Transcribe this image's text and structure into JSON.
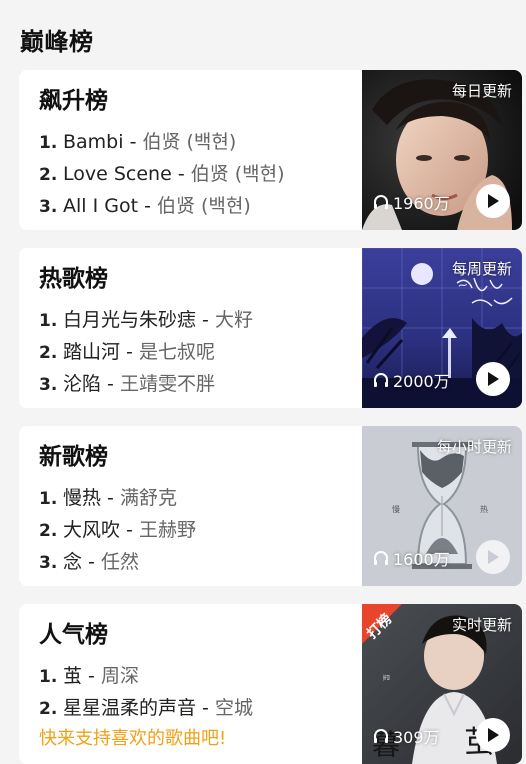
{
  "page": {
    "section_title": "巅峰榜"
  },
  "charts": [
    {
      "title": "飙升榜",
      "update": "每日更新",
      "plays": "1960万",
      "songs": [
        {
          "rank": "1.",
          "title": "Bambi",
          "artist": "伯贤 (백현)"
        },
        {
          "rank": "2.",
          "title": "Love Scene",
          "artist": "伯贤 (백현)"
        },
        {
          "rank": "3.",
          "title": "All I Got",
          "artist": "伯贤 (백현)"
        }
      ]
    },
    {
      "title": "热歌榜",
      "update": "每周更新",
      "plays": "2000万",
      "songs": [
        {
          "rank": "1.",
          "title": "白月光与朱砂痣",
          "artist": "大籽"
        },
        {
          "rank": "2.",
          "title": "踏山河",
          "artist": "是七叔呢"
        },
        {
          "rank": "3.",
          "title": "沦陷",
          "artist": "王靖雯不胖"
        }
      ]
    },
    {
      "title": "新歌榜",
      "update": "每小时更新",
      "plays": "1600万",
      "songs": [
        {
          "rank": "1.",
          "title": "慢热",
          "artist": "满舒克"
        },
        {
          "rank": "2.",
          "title": "大风吹",
          "artist": "王赫野"
        },
        {
          "rank": "3.",
          "title": "念",
          "artist": "任然"
        }
      ]
    },
    {
      "title": "人气榜",
      "update": "实时更新",
      "plays": "309万",
      "badge": "打榜",
      "songs": [
        {
          "rank": "1.",
          "title": "茧",
          "artist": "周深"
        },
        {
          "rank": "2.",
          "title": "星星温柔的声音",
          "artist": "空城"
        }
      ],
      "promo": "快来支持喜欢的歌曲吧!"
    }
  ],
  "sep": " - ",
  "colors": {
    "accent_orange": "#f2a016",
    "badge_red": "#e8452d",
    "card_bg": "#ffffff",
    "page_bg": "#f4f4f4"
  },
  "icons": {
    "plays": "headphones-icon",
    "play": "play-icon"
  }
}
